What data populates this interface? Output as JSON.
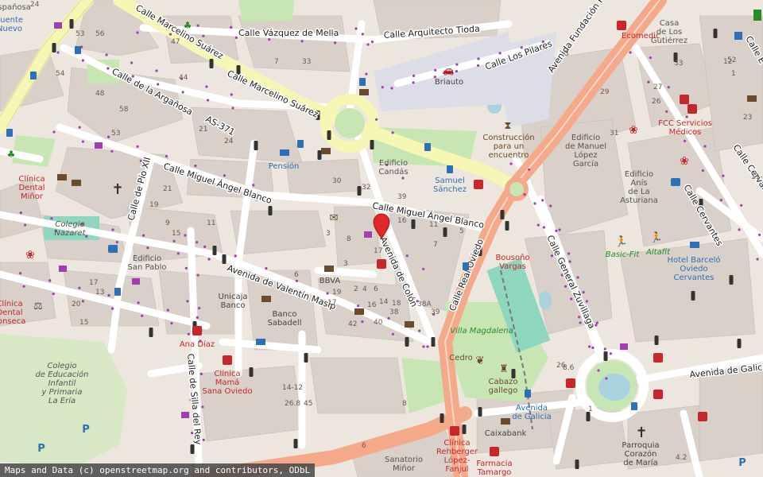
{
  "attribution": "Maps and Data (c) openstreetmap.org and contributors, ODbL",
  "colors": {
    "land": "#f2efe9",
    "building": "#d9d0c9",
    "primary": "#f4a98a",
    "secondary": "#f7f7b5",
    "park": "#c8e6b4",
    "water": "#aad3df",
    "marker": "#e02a2a"
  },
  "streets": {
    "vazquez_de_mella": "Calle Vázquez de Mella",
    "arquitecto_tioda": "Calle Arquitecto Tioda",
    "marcelino_suarez_1": "Calle Marcelino Suárez",
    "marcelino_suarez_2": "Calle Marcelino Suárez",
    "los_pilares": "Calle Los Pilares",
    "fundacion_principe": "Avenida Fundación Prin",
    "arganosa": "Calle de la Argañosa",
    "as371": "AS-371",
    "miguel_angel_blanco_1": "Calle Miguel Ángel Blanco",
    "miguel_angel_blanco_2": "Calle Miguel Ángel Blanco",
    "pio_xii": "Calle de Pío XII",
    "valentin_masip": "Avenida de Valentín Masip",
    "colon": "Avenida de Colón",
    "real_oviedo": "Calle Real Oviedo",
    "general_zuvillaga": "Calle General Zuvillaga",
    "cervantes_1": "Calle Cervantes",
    "cervantes_2": "Calle Cervantes",
    "silla_del_rey": "Calle de Silla del Rey",
    "avenida_galicia": "Avenida de Galicia",
    "calle_e": "Calle E"
  },
  "pois": {
    "ecomedic": "Ecomedic",
    "casa_gutierrez": "Casa\nde Los\nGutiérrez",
    "briauto": "Briauto",
    "construccion": "Construcción\npara un\nencuentro",
    "edificio_candas": "Edificio\nCandás",
    "samuel_sanchez": "Samuel\nSánchez",
    "pension": "Pensión",
    "edificio_manuel": "Edificio\nde Manuel\nLópez\nGarcía",
    "edificio_anis": "Edificio\nAnís\nde La\nAsturiana",
    "fcc": "FCC Servicios\nMédicos",
    "clinica_minor": "Clínica\nDental\nMiñor",
    "colegio_nazaret": "Colegio\nNazaret",
    "edificio_sanpablo": "Edificio\nSan Pablo",
    "bbva": "BBVA",
    "bousono": "Bousoño\nVargas",
    "basic_fit": "Basic-Fit",
    "altafit": "Altafit",
    "hotel_barcelo": "Hotel Barceló\nOviedo\nCervantes",
    "unicaja": "Unicaja\nBanco",
    "sabadell": "Banco\nSabadell",
    "ana_diaz": "Ana Díaz",
    "villa_magdalena": "Villa Magdalena",
    "cedro": "Cedro",
    "cabazo": "Cabazo\ngallego",
    "clinica_fonseca": "Clínica\nDental\nFonseca",
    "colegio_educacion": "Colegio\nde Educación\nInfantil\ny Primaria\nLa Ería",
    "clinica_mama": "Clínica\nMamá\nSana Oviedo",
    "avenida_galicia_stop": "Avenida\nde Galicia",
    "caixabank": "Caixabank",
    "clinica_rehberger": "Clínica\nRehberger\nLópez-\nFanjul",
    "farmacia_tamargo": "Farmacia\nTamargo",
    "sanatorio_minor": "Sanatorio\nMiñor",
    "parroquia": "Parroquia\nCorazón\nde María",
    "espanosa": "Españosa",
    "fuente_nuevo": "Fuente\nNuevo"
  },
  "house_numbers": [
    "53",
    "56",
    "54",
    "58",
    "47",
    "44",
    "7",
    "33",
    "48",
    "53",
    "21",
    "24",
    "30",
    "32",
    "39",
    "17",
    "16",
    "11",
    "5",
    "7",
    "29",
    "31",
    "26",
    "33",
    "3",
    "12",
    "21",
    "19",
    "9",
    "15",
    "11",
    "3",
    "6",
    "8",
    "3",
    "19",
    "17",
    "2",
    "4",
    "6",
    "16",
    "18",
    "14",
    "38",
    "40",
    "42",
    "8",
    "6",
    "38A",
    "39",
    "17",
    "13",
    "26",
    "20",
    "15",
    "24",
    "27",
    "4.2",
    "1",
    "8.6",
    "14-12",
    "26.8",
    "45",
    "52",
    "1",
    "23",
    "11-9",
    "12",
    "14"
  ]
}
